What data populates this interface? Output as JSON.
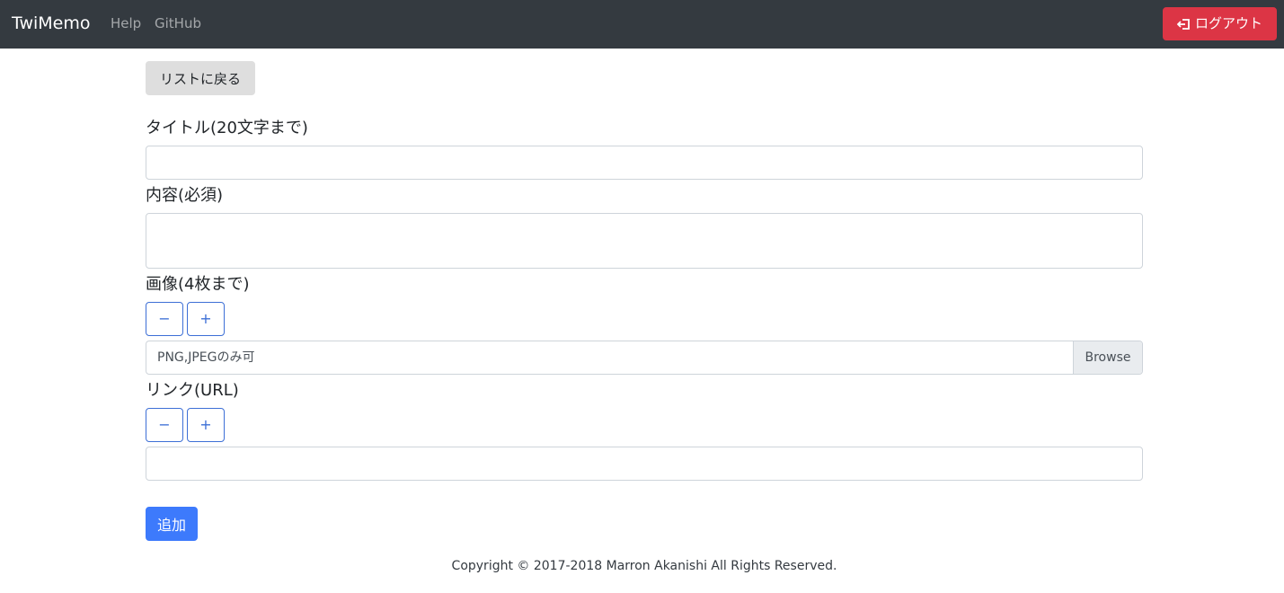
{
  "navbar": {
    "brand": "TwiMemo",
    "links": [
      {
        "label": "Help"
      },
      {
        "label": "GitHub"
      }
    ],
    "logout_label": "ログアウト"
  },
  "back_button": "リストに戻る",
  "form": {
    "title_label": "タイトル(20文字まで)",
    "title_value": "",
    "content_label": "内容(必須)",
    "content_value": "",
    "image_label": "画像(4枚まで)",
    "image_placeholder": "PNG,JPEGのみ可",
    "browse_label": "Browse",
    "link_label": "リンク(URL)",
    "link_value": "",
    "minus_label": "−",
    "plus_label": "+",
    "submit_label": "追加"
  },
  "footer": {
    "copyright": "Copyright © 2017-2018 Marron Akanishi All Rights Reserved."
  },
  "colors": {
    "navbar_bg": "#343a40",
    "danger": "#dc3545",
    "primary": "#3d7afc",
    "outline_primary": "#3d6fd6",
    "secondary_bg": "#dedede"
  },
  "icons": {
    "logout": "sign-out-icon"
  }
}
